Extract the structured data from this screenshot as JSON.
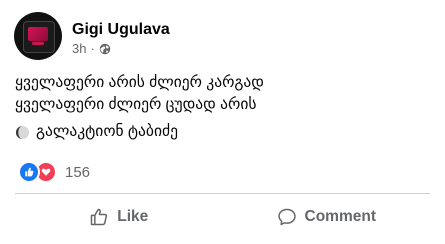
{
  "post": {
    "author": "Gigi Ugulava",
    "time": "3h",
    "separator": "·",
    "privacy_icon": "globe-icon",
    "lines": [
      "ყველაფერი არის ძლიერ კარგად",
      "ყველაფერი ძლიერ ცუდად არის",
      "გალაკტიონ ტაბიძე"
    ],
    "moon_icon": "moon-icon"
  },
  "reactions": {
    "icons": [
      "like-reaction-icon",
      "love-reaction-icon"
    ],
    "count": "156",
    "colors": {
      "like": "#1877f2",
      "love": "#f33e58"
    }
  },
  "actions": {
    "like_label": "Like",
    "comment_label": "Comment"
  },
  "colors": {
    "text": "#050505",
    "secondary": "#65676b",
    "divider": "#ced0d4"
  }
}
